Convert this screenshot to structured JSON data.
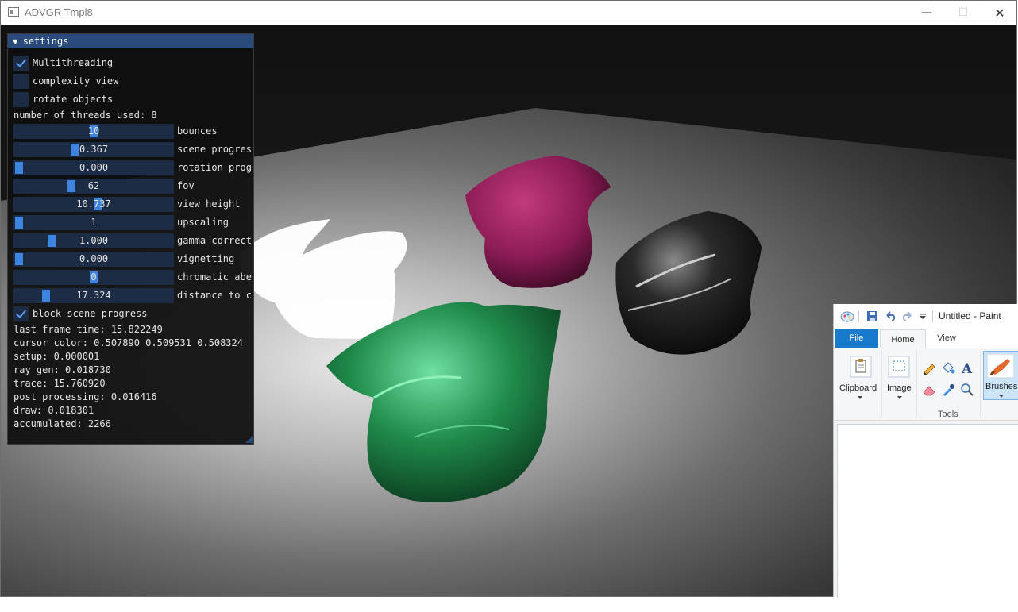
{
  "window": {
    "title": "ADVGR Tmpl8",
    "minimize_glyph": "—",
    "maximize_glyph": "☐",
    "close_glyph": "✕"
  },
  "settings": {
    "title": "settings",
    "collapse_glyph": "▼",
    "checkboxes": [
      {
        "label": "Multithreading",
        "checked": true
      },
      {
        "label": "complexity view",
        "checked": false
      },
      {
        "label": "rotate objects",
        "checked": false
      }
    ],
    "threads_text": "number of threads used: 8",
    "sliders": [
      {
        "value": "10",
        "label": "bounces",
        "level": 0.5
      },
      {
        "value": "0.367",
        "label": "scene progress",
        "level": 0.37
      },
      {
        "value": "0.000",
        "label": "rotation progress",
        "level": 0.0
      },
      {
        "value": "62",
        "label": "fov",
        "level": 0.35
      },
      {
        "value": "10.737",
        "label": "view height",
        "level": 0.53
      },
      {
        "value": "1",
        "label": "upscaling",
        "level": 0.0
      },
      {
        "value": "1.000",
        "label": "gamma correction",
        "level": 0.22
      },
      {
        "value": "0.000",
        "label": "vignetting",
        "level": 0.0
      },
      {
        "value": "0",
        "label": "chromatic aberration",
        "level": 0.5
      },
      {
        "value": "17.324",
        "label": "distance to camera",
        "level": 0.18
      }
    ],
    "block_checkbox": {
      "label": "block scene progress",
      "checked": true
    },
    "stats": [
      "last frame time: 15.822249",
      "cursor color: 0.507890 0.509531 0.508324",
      "setup: 0.000001",
      "ray gen: 0.018730",
      "trace: 15.760920",
      "post_processing: 0.016416",
      "draw: 0.018301",
      "accumulated: 2266"
    ]
  },
  "paint": {
    "title": "Untitled - Paint",
    "tabs": {
      "file": "File",
      "home": "Home",
      "view": "View"
    },
    "groups": {
      "clipboard": "Clipboard",
      "image": "Image",
      "tools": "Tools",
      "brushes": "Brushes"
    }
  },
  "colors": {
    "imgui_title": "#294a7a",
    "imgui_frame": "#1c2c44",
    "imgui_grab": "#3d85e0",
    "dragon_green": "#1f8a4a",
    "dragon_magenta": "#8a1b55",
    "paint_accent": "#1979ca"
  }
}
